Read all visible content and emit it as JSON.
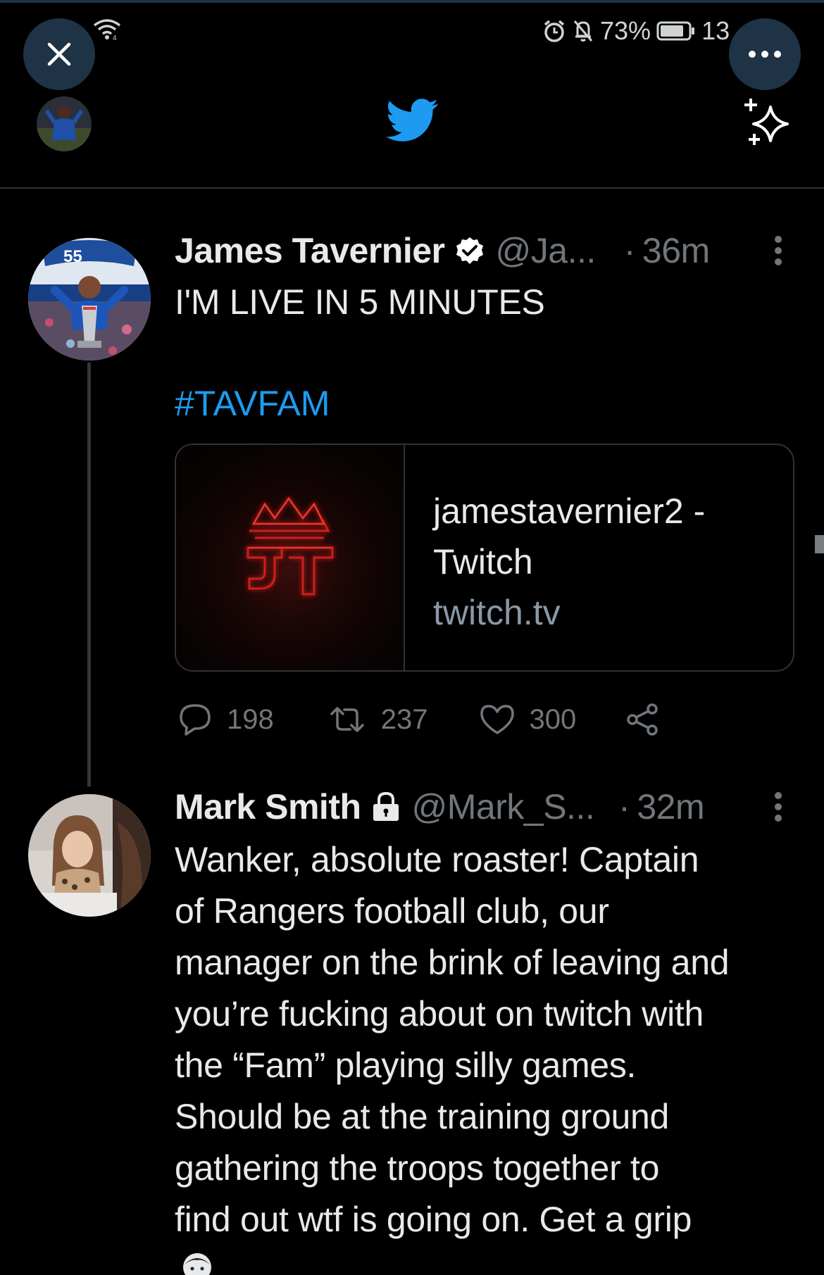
{
  "status_bar": {
    "battery": "73%",
    "clock": "13"
  },
  "header": {
    "close_icon": "close-icon",
    "more_icon": "more-icon",
    "logo_icon": "twitter-bird-icon",
    "sparkle_icon": "sparkle-icon"
  },
  "tweets": [
    {
      "name": "James Tavernier",
      "handle": "@Ja...",
      "time": "36m",
      "text": "I'M LIVE IN 5 MINUTES",
      "hashtag": "#TAVFAM",
      "card": {
        "title": "jamestavernier2 - Twitch",
        "domain": "twitch.tv"
      },
      "stats": {
        "replies": "198",
        "retweets": "237",
        "likes": "300"
      }
    },
    {
      "name": "Mark Smith",
      "handle": "@Mark_S...",
      "time": "32m",
      "lines": [
        "Wanker, absolute roaster! Captain",
        "of Rangers football club, our",
        "manager on the brink of leaving and",
        "you’re fucking about on twitch with",
        "the “Fam” playing silly games.",
        "Should be at the training ground",
        "gathering the troops together to",
        "find out wtf is going on. Get a grip"
      ]
    }
  ],
  "colors": {
    "background": "#000000",
    "accent": "#1d9bf0",
    "secondary_text": "#71767b",
    "card_glow": "#e0201a"
  }
}
